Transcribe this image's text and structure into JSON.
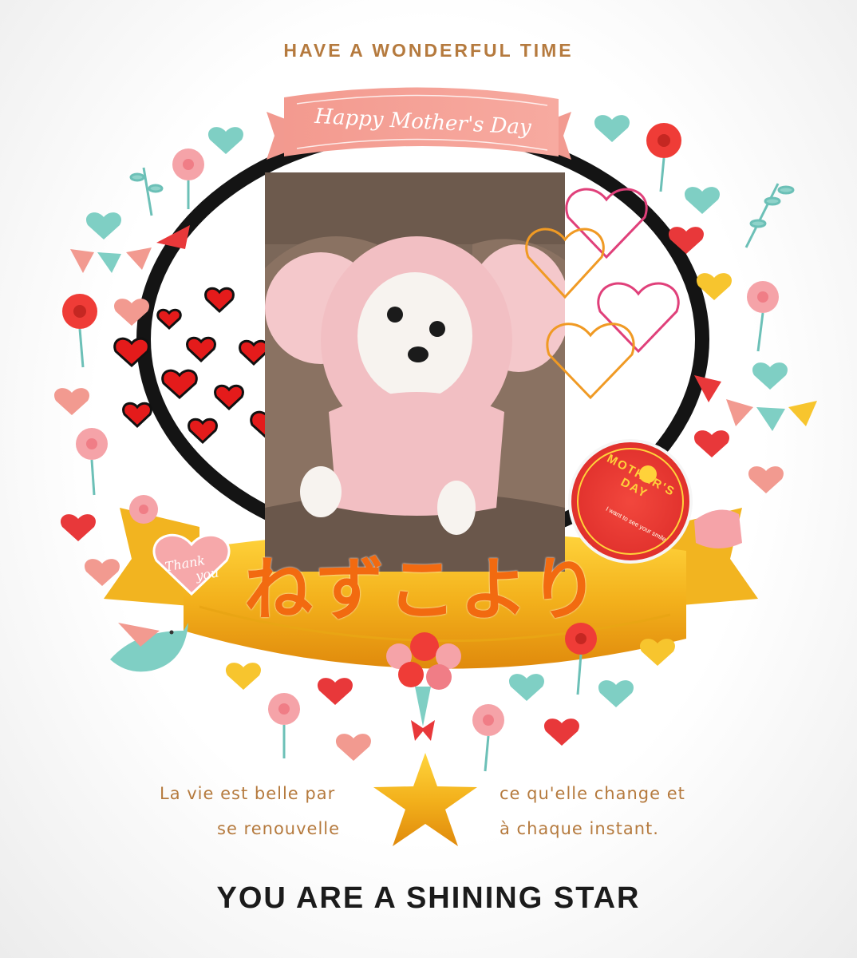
{
  "header": {
    "tagline": "HAVE A WONDERFUL TIME"
  },
  "banner": {
    "title": "Happy Mother's Day"
  },
  "photo": {
    "subject": "white dog in pink hooded outfit"
  },
  "name_text": "ねずこより",
  "thank_card": {
    "line1": "Thank",
    "line2": "you"
  },
  "stamp": {
    "title_line1": "MOTHER'S",
    "title_line2": "DAY",
    "subtitle": "I want to see your smile"
  },
  "quote": {
    "left_line1": "La vie est belle par",
    "left_line2": "se renouvelle",
    "right_line1": "ce qu'elle change et",
    "right_line2": "à chaque instant."
  },
  "footer": {
    "slogan": "YOU ARE A SHINING STAR"
  },
  "colors": {
    "accent_text": "#b57a3e",
    "banner_pink": "#f29a90",
    "ribbon_gold": "#f0b321",
    "name_orange": "#f26a10"
  }
}
